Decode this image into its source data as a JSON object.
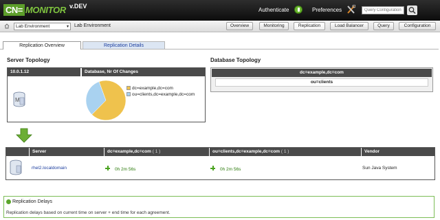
{
  "header": {
    "logo_cn": "CN=",
    "logo_monitor": "MONITOR",
    "version": "v.DEV",
    "authenticate_label": "Authenticate",
    "preferences_label": "Preferences",
    "search_placeholder": "Query Configuration"
  },
  "navbar": {
    "environment_select": "Lab Environment",
    "environment_label": "Lab Environment",
    "buttons": [
      "Overview",
      "Monitoring",
      "Replication",
      "Load Balancer",
      "Query",
      "Configuration"
    ]
  },
  "tabs": {
    "active": "Replication Overview",
    "inactive": "Replication Details"
  },
  "server_topology": {
    "title": "Server Topology",
    "server_header": "10.0.1.12",
    "chart_header": "Database, Nr Of Changes",
    "server_icon_letter": "M"
  },
  "chart_data": {
    "type": "pie",
    "title": "Database, Nr Of Changes",
    "slices": [
      {
        "label": "dc=example,dc=com",
        "value": 68,
        "color": "#efc24d"
      },
      {
        "label": "ou=clients,dc=example,dc=com",
        "value": 32,
        "color": "#a9d2f0"
      }
    ],
    "legend_position": "right"
  },
  "database_topology": {
    "title": "Database Topology",
    "header": "dc=example,dc=com",
    "child": "ou=clients"
  },
  "replication_table": {
    "columns": [
      {
        "label": "Server",
        "count": ""
      },
      {
        "label": "dc=example,dc=com",
        "count": "( 1 )"
      },
      {
        "label": "ou=clients,dc=example,dc=com",
        "count": "( 1 )"
      },
      {
        "label": "Vendor",
        "count": ""
      }
    ],
    "row": {
      "server": "rhel2.localdomain",
      "delay_1": "0h 2m 56s",
      "delay_2": "0h 2m 56s",
      "vendor": "Sun Java System"
    }
  },
  "delays": {
    "title": "Replication Delays",
    "text": "Replication delays based on current time on server + end time for each agreement."
  },
  "colors": {
    "accent_green": "#5d9e2b",
    "header_dark": "#4a4a4a",
    "link_blue": "#1b3d9e"
  }
}
